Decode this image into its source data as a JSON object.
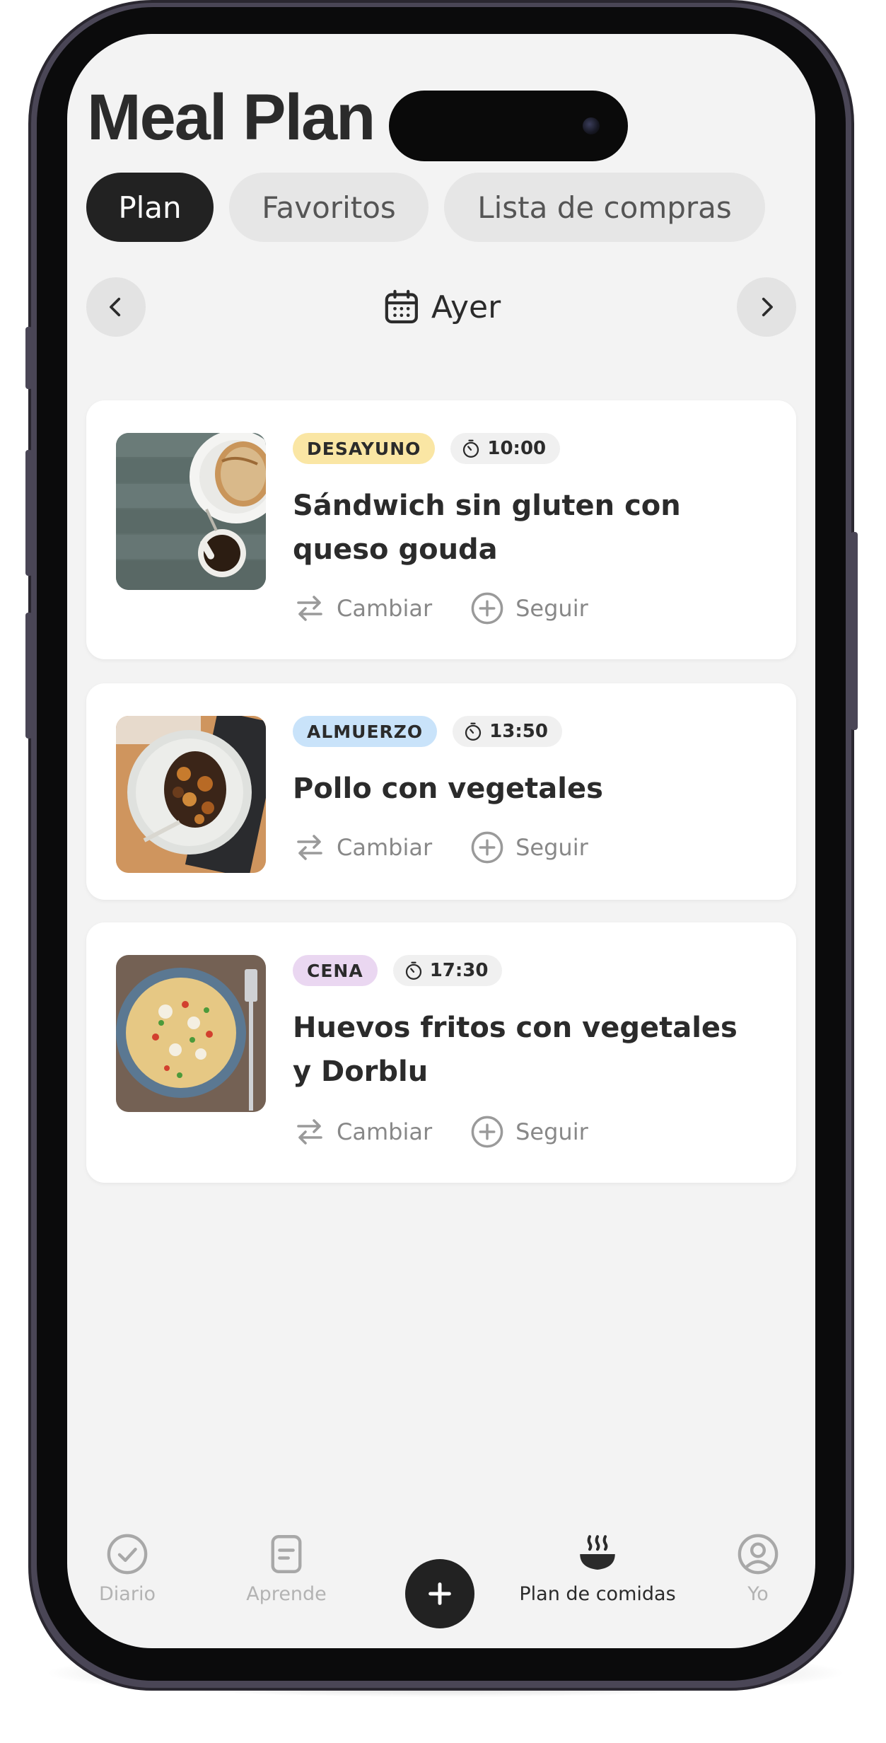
{
  "header": {
    "title": "Meal Plan"
  },
  "tabs": [
    {
      "label": "Plan",
      "active": true
    },
    {
      "label": "Favoritos",
      "active": false
    },
    {
      "label": "Lista de compras",
      "active": false
    }
  ],
  "date_nav": {
    "label": "Ayer",
    "icon": "calendar-icon"
  },
  "meals": [
    {
      "tag": "DESAYUNO",
      "tag_color": "#fae6a4",
      "time": "10:00",
      "title": "Sándwich sin gluten con queso gouda",
      "change_label": "Cambiar",
      "follow_label": "Seguir"
    },
    {
      "tag": "ALMUERZO",
      "tag_color": "#c9e3fa",
      "time": "13:50",
      "title": "Pollo con vegetales",
      "change_label": "Cambiar",
      "follow_label": "Seguir"
    },
    {
      "tag": "CENA",
      "tag_color": "#ead7f1",
      "time": "17:30",
      "title": "Huevos fritos con vegetales y Dorblu",
      "change_label": "Cambiar",
      "follow_label": "Seguir"
    }
  ],
  "bottom_nav": {
    "items": [
      {
        "label": "Diario",
        "icon": "check-circle-icon",
        "active": false
      },
      {
        "label": "Aprende",
        "icon": "document-icon",
        "active": false
      },
      {
        "label": "Plan de comidas",
        "icon": "steaming-bowl-icon",
        "active": true
      },
      {
        "label": "Yo",
        "icon": "user-circle-icon",
        "active": false
      }
    ],
    "add_icon": "plus-icon"
  }
}
